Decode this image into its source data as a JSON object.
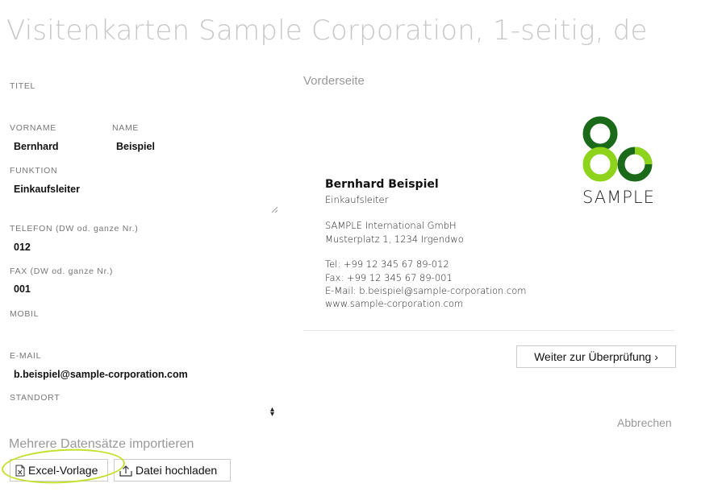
{
  "page": {
    "title": "Visitenkarten Sample Corporation, 1-seitig, de"
  },
  "form": {
    "titel": {
      "label": "TITEL",
      "value": ""
    },
    "vorname": {
      "label": "VORNAME",
      "value": "Bernhard"
    },
    "name": {
      "label": "NAME",
      "value": "Beispiel"
    },
    "funktion": {
      "label": "FUNKTION",
      "value": "Einkaufsleiter"
    },
    "telefon": {
      "label": "TELEFON (DW od. ganze Nr.)",
      "value": "012"
    },
    "fax": {
      "label": "FAX (DW od. ganze Nr.)",
      "value": "001"
    },
    "mobil": {
      "label": "MOBIL",
      "value": ""
    },
    "email": {
      "label": "E-MAIL",
      "value": "b.beispiel@sample-corporation.com"
    },
    "standort": {
      "label": "STANDORT",
      "value": ""
    }
  },
  "import": {
    "title": "Mehrere Datensätze importieren",
    "excel_label": "Excel-Vorlage",
    "upload_label": "Datei hochladen"
  },
  "preview": {
    "heading": "Vorderseite",
    "name": "Bernhard Beispiel",
    "function": "Einkaufsleiter",
    "company": "SAMPLE International GmbH",
    "address": "Musterplatz 1, 1234 Irgendwo",
    "tel": "Tel: +99 12 345 67 89-012",
    "fax": "Fax: +99 12 345 67 89-001",
    "email": "E-Mail: b.beispiel@sample-corporation.com",
    "web": "www.sample-corporation.com",
    "logo_text": "SAMPLE"
  },
  "actions": {
    "next_label": "Weiter zur Überprüfung ›",
    "cancel_label": "Abbrechen"
  },
  "colors": {
    "logo_dark": "#1a6a1a",
    "logo_light": "#8fd41c",
    "highlight": "#c5e02c"
  }
}
